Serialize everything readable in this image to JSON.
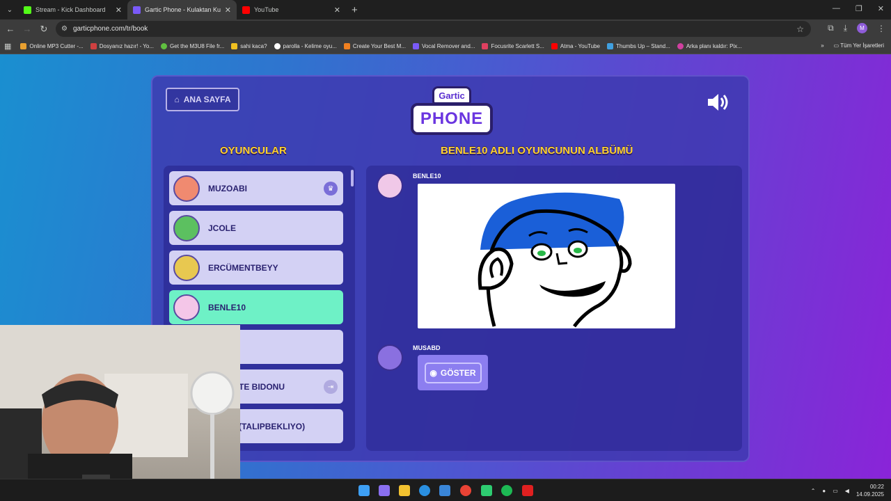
{
  "browser": {
    "tabs": [
      {
        "title": "Stream - Kick Dashboard",
        "color": "#53fc18"
      },
      {
        "title": "Gartic Phone - Kulaktan Kulağa",
        "color": "#7a5af8"
      },
      {
        "title": "YouTube",
        "color": "#ff0000"
      }
    ],
    "url": "garticphone.com/tr/book",
    "profile_initial": "M",
    "bookmarks": [
      {
        "label": "Online MP3 Cutter -...",
        "color": "#e8a030"
      },
      {
        "label": "Dosyanız hazır! - Yo...",
        "color": "#d04040"
      },
      {
        "label": "Get the M3U8 File fr...",
        "color": "#60c040"
      },
      {
        "label": "sahi kaca?",
        "color": "#f0c020"
      },
      {
        "label": "parolla - Kelime oyu...",
        "color": "#ffffff"
      },
      {
        "label": "Create Your Best M...",
        "color": "#f08020"
      },
      {
        "label": "Vocal Remover and...",
        "color": "#7a5af8"
      },
      {
        "label": "Focusrite Scarlett S...",
        "color": "#e04060"
      },
      {
        "label": "Atma - YouTube",
        "color": "#ff0000"
      },
      {
        "label": "Thumbs Up – Stand...",
        "color": "#40a0e0"
      },
      {
        "label": "Arka planı kaldır: Pix...",
        "color": "#d040a0"
      }
    ],
    "bookmarks_folder": "Tüm Yer İşaretleri"
  },
  "game": {
    "home_label": "ANA SAYFA",
    "logo_top": "Gartic",
    "logo_bottom": "PHONE",
    "players_title": "OYUNCULAR",
    "album_title": "BENLE10 ADLI OYUNCUNUN ALBÜMÜ",
    "players": [
      {
        "name": "MUZOABI",
        "badge": "crown"
      },
      {
        "name": "JCOLE",
        "badge": ""
      },
      {
        "name": "ERCÜMENTBEYY",
        "badge": ""
      },
      {
        "name": "BENLE10",
        "badge": "",
        "active": true
      },
      {
        "name": "",
        "badge": ""
      },
      {
        "name": "TE BIDONU",
        "badge": "exit"
      },
      {
        "name": "(TALIPBEKLIYO)",
        "badge": ""
      }
    ],
    "entries": [
      {
        "name": "BENLE10"
      },
      {
        "name": "MUSABD"
      }
    ],
    "show_label": "GÖSTER"
  },
  "taskbar": {
    "time": "00:22",
    "date": "14.09.2025"
  }
}
